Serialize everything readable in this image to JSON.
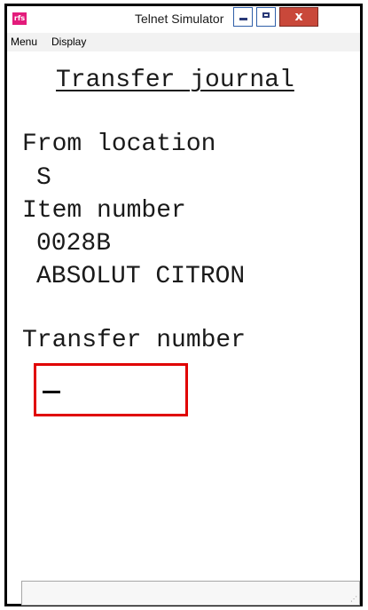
{
  "window": {
    "title": "Telnet Simulator",
    "app_icon_text": "rfs",
    "close_glyph": "x"
  },
  "menubar": {
    "items": [
      "Menu",
      "Display"
    ]
  },
  "terminal": {
    "heading": "Transfer journal",
    "lines": [
      "From location",
      "S",
      "Item number",
      "0028B",
      "ABSOLUT CITRON",
      "Transfer number"
    ],
    "input": {
      "value": "",
      "highlight_color": "#e00000"
    }
  }
}
